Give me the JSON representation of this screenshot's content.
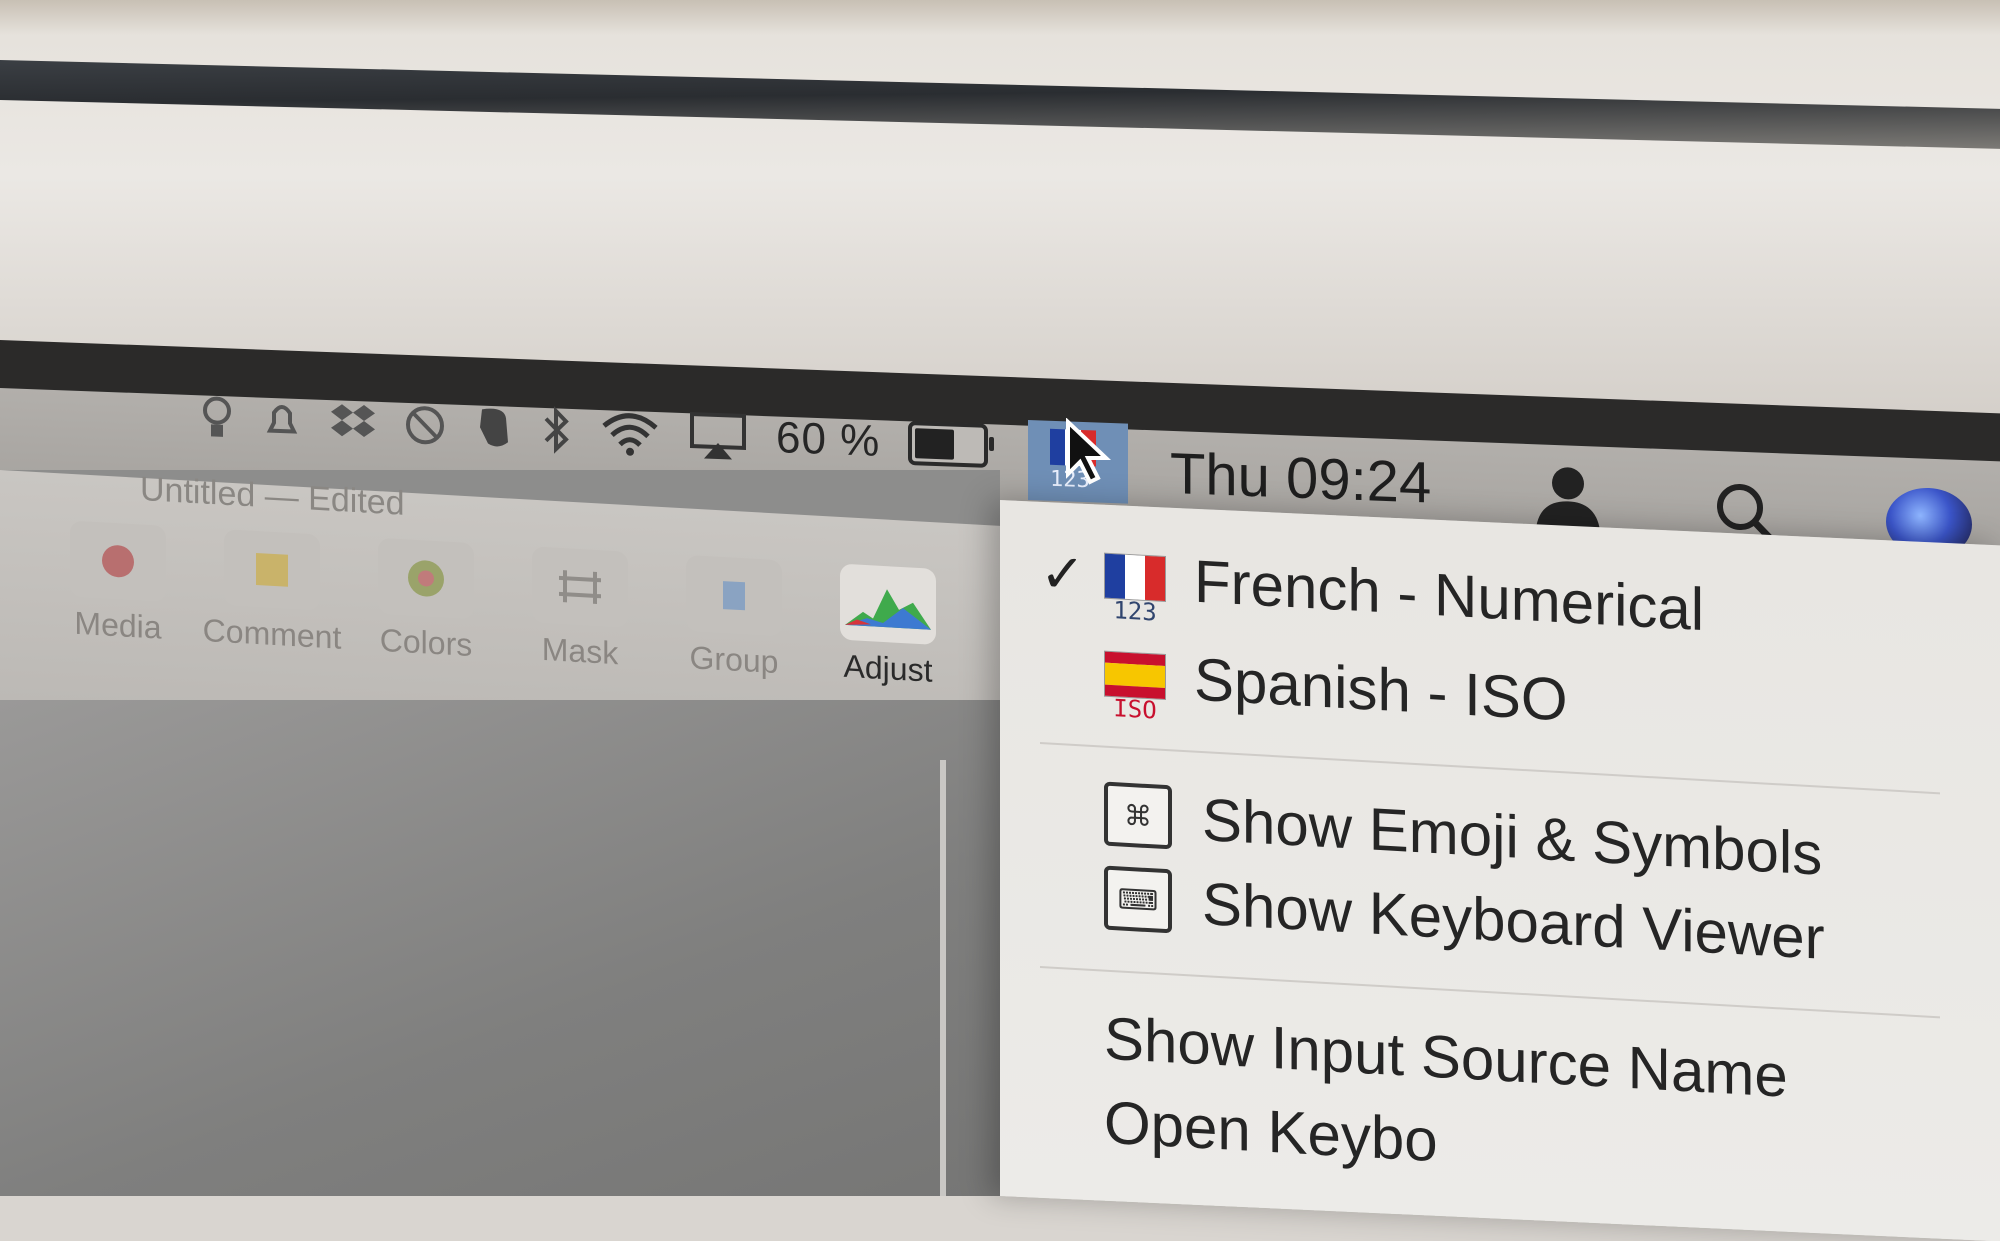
{
  "menubar": {
    "battery_percent": "60 %",
    "battery_level": 0.6,
    "clock": "Thu 09:24",
    "status_icons": [
      "tips-icon",
      "notification-bell-icon",
      "dropbox-icon",
      "do-not-disturb-icon",
      "evernote-icon",
      "bluetooth-icon",
      "wifi-icon",
      "airplay-icon"
    ],
    "input_menu_code": "123"
  },
  "app": {
    "document_title": "Untitled — Edited",
    "toolbar": [
      {
        "label": "Media",
        "icon": "media-icon"
      },
      {
        "label": "Comment",
        "icon": "comment-icon"
      },
      {
        "label": "Colors",
        "icon": "colors-icon"
      },
      {
        "label": "Mask",
        "icon": "mask-icon"
      },
      {
        "label": "Group",
        "icon": "group-icon"
      },
      {
        "label": "Adjust",
        "icon": "adjust-icon"
      }
    ]
  },
  "input_menu": {
    "sources": [
      {
        "label": "French - Numerical",
        "code": "123",
        "checked": true,
        "flag_colors": [
          "#1f3fa0",
          "#ffffff",
          "#d82b2b"
        ]
      },
      {
        "label": "Spanish - ISO",
        "code": "ISO",
        "checked": false,
        "flag_colors": [
          "#c8102e",
          "#f7c600",
          "#c8102e"
        ]
      }
    ],
    "check_glyph": "✓",
    "actions": [
      {
        "label": "Show Emoji & Symbols",
        "icon_glyph": "⌘"
      },
      {
        "label": "Show Keyboard Viewer",
        "icon_glyph": "⌨"
      }
    ],
    "show_input_source_name": "Show Input Source Name",
    "open_keyboard_prefs": "Open Keybo"
  }
}
